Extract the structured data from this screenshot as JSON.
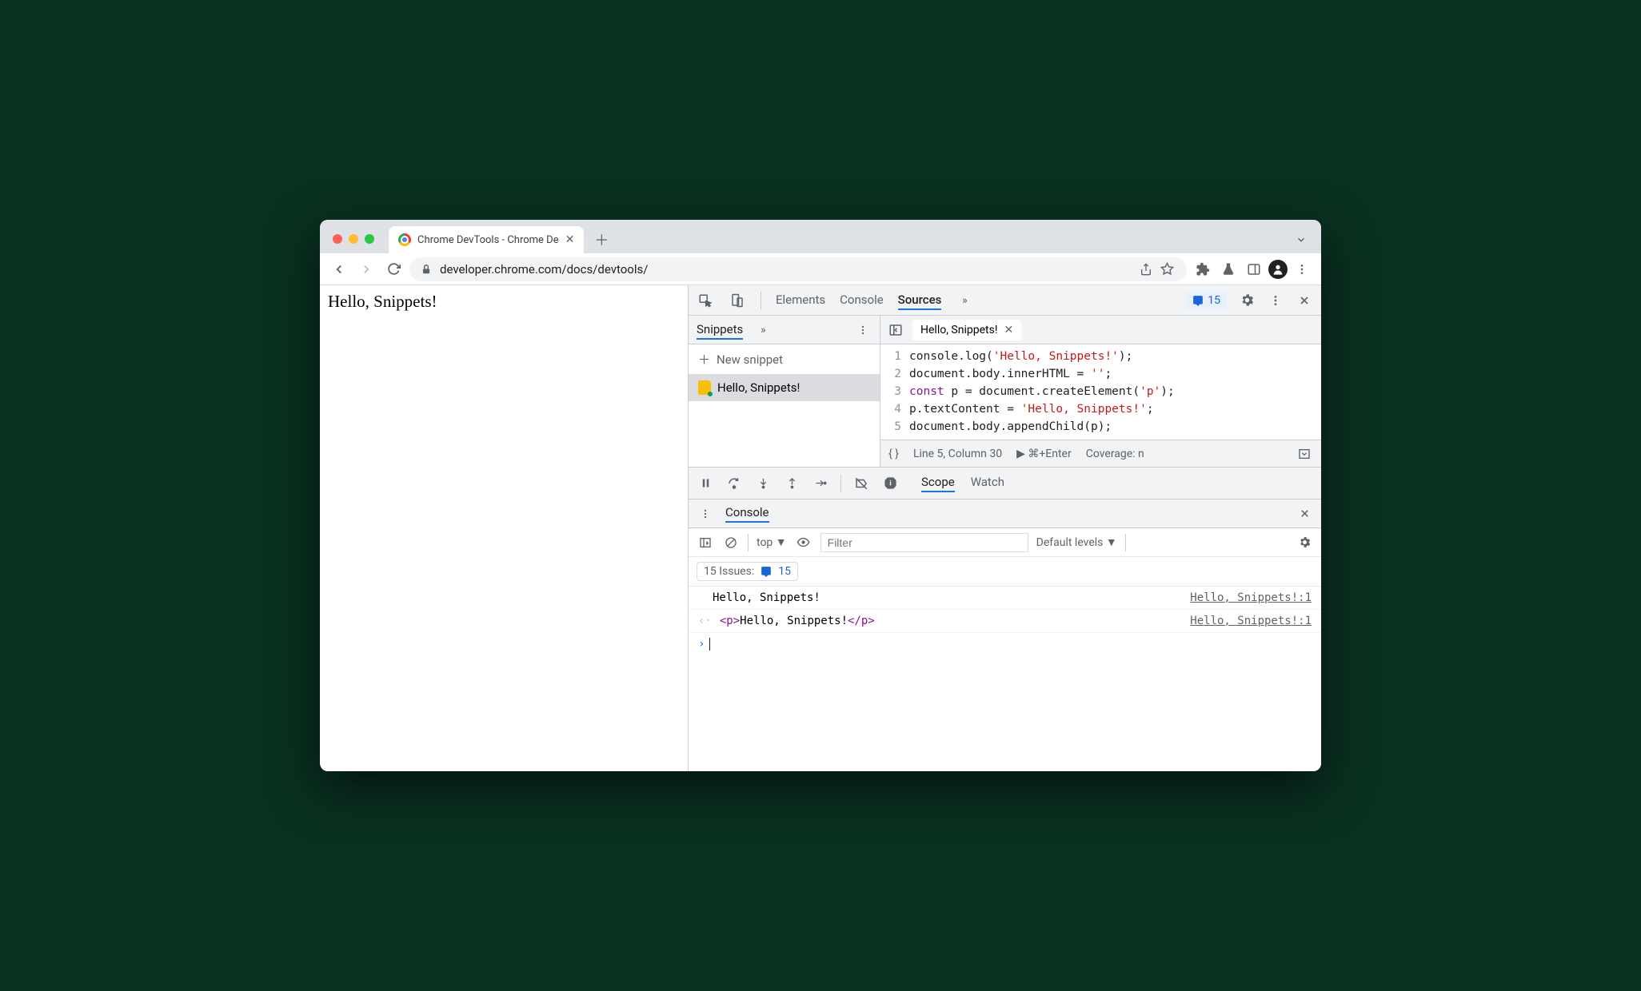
{
  "browser": {
    "tab_title": "Chrome DevTools - Chrome De",
    "url": "developer.chrome.com/docs/devtools/"
  },
  "page": {
    "text": "Hello, Snippets!"
  },
  "devtools": {
    "tabs": {
      "elements": "Elements",
      "console": "Console",
      "sources": "Sources"
    },
    "issues_count": "15",
    "sources": {
      "nav_tab": "Snippets",
      "new_snippet": "New snippet",
      "snippet_name": "Hello, Snippets!",
      "open_file": "Hello, Snippets!",
      "code": {
        "1": {
          "pre": "console.log(",
          "str": "'Hello, Snippets!'",
          "post": ");"
        },
        "2": {
          "pre": "document.body.innerHTML = ",
          "str": "''",
          "post": ";"
        },
        "3": {
          "kw": "const",
          "mid": " p = document.createElement(",
          "str": "'p'",
          "post": ");"
        },
        "4": {
          "pre": "p.textContent = ",
          "str": "'Hello, Snippets!'",
          "post": ";"
        },
        "5": {
          "pre": "document.body.appendChild(p);"
        }
      },
      "status": {
        "pos": "Line 5, Column 30",
        "run": "⌘+Enter",
        "coverage": "Coverage: n"
      }
    },
    "debugger": {
      "scope": "Scope",
      "watch": "Watch"
    },
    "console_drawer": {
      "title": "Console",
      "context": "top",
      "filter_placeholder": "Filter",
      "levels": "Default levels",
      "issues_label": "15 Issues:",
      "issues_count": "15",
      "lines": [
        {
          "msg": "Hello, Snippets!",
          "src": "Hello, Snippets!:1"
        },
        {
          "msg_html": {
            "open": "<p>",
            "text": "Hello, Snippets!",
            "close": "</p>"
          },
          "src": "Hello, Snippets!:1"
        }
      ]
    }
  }
}
